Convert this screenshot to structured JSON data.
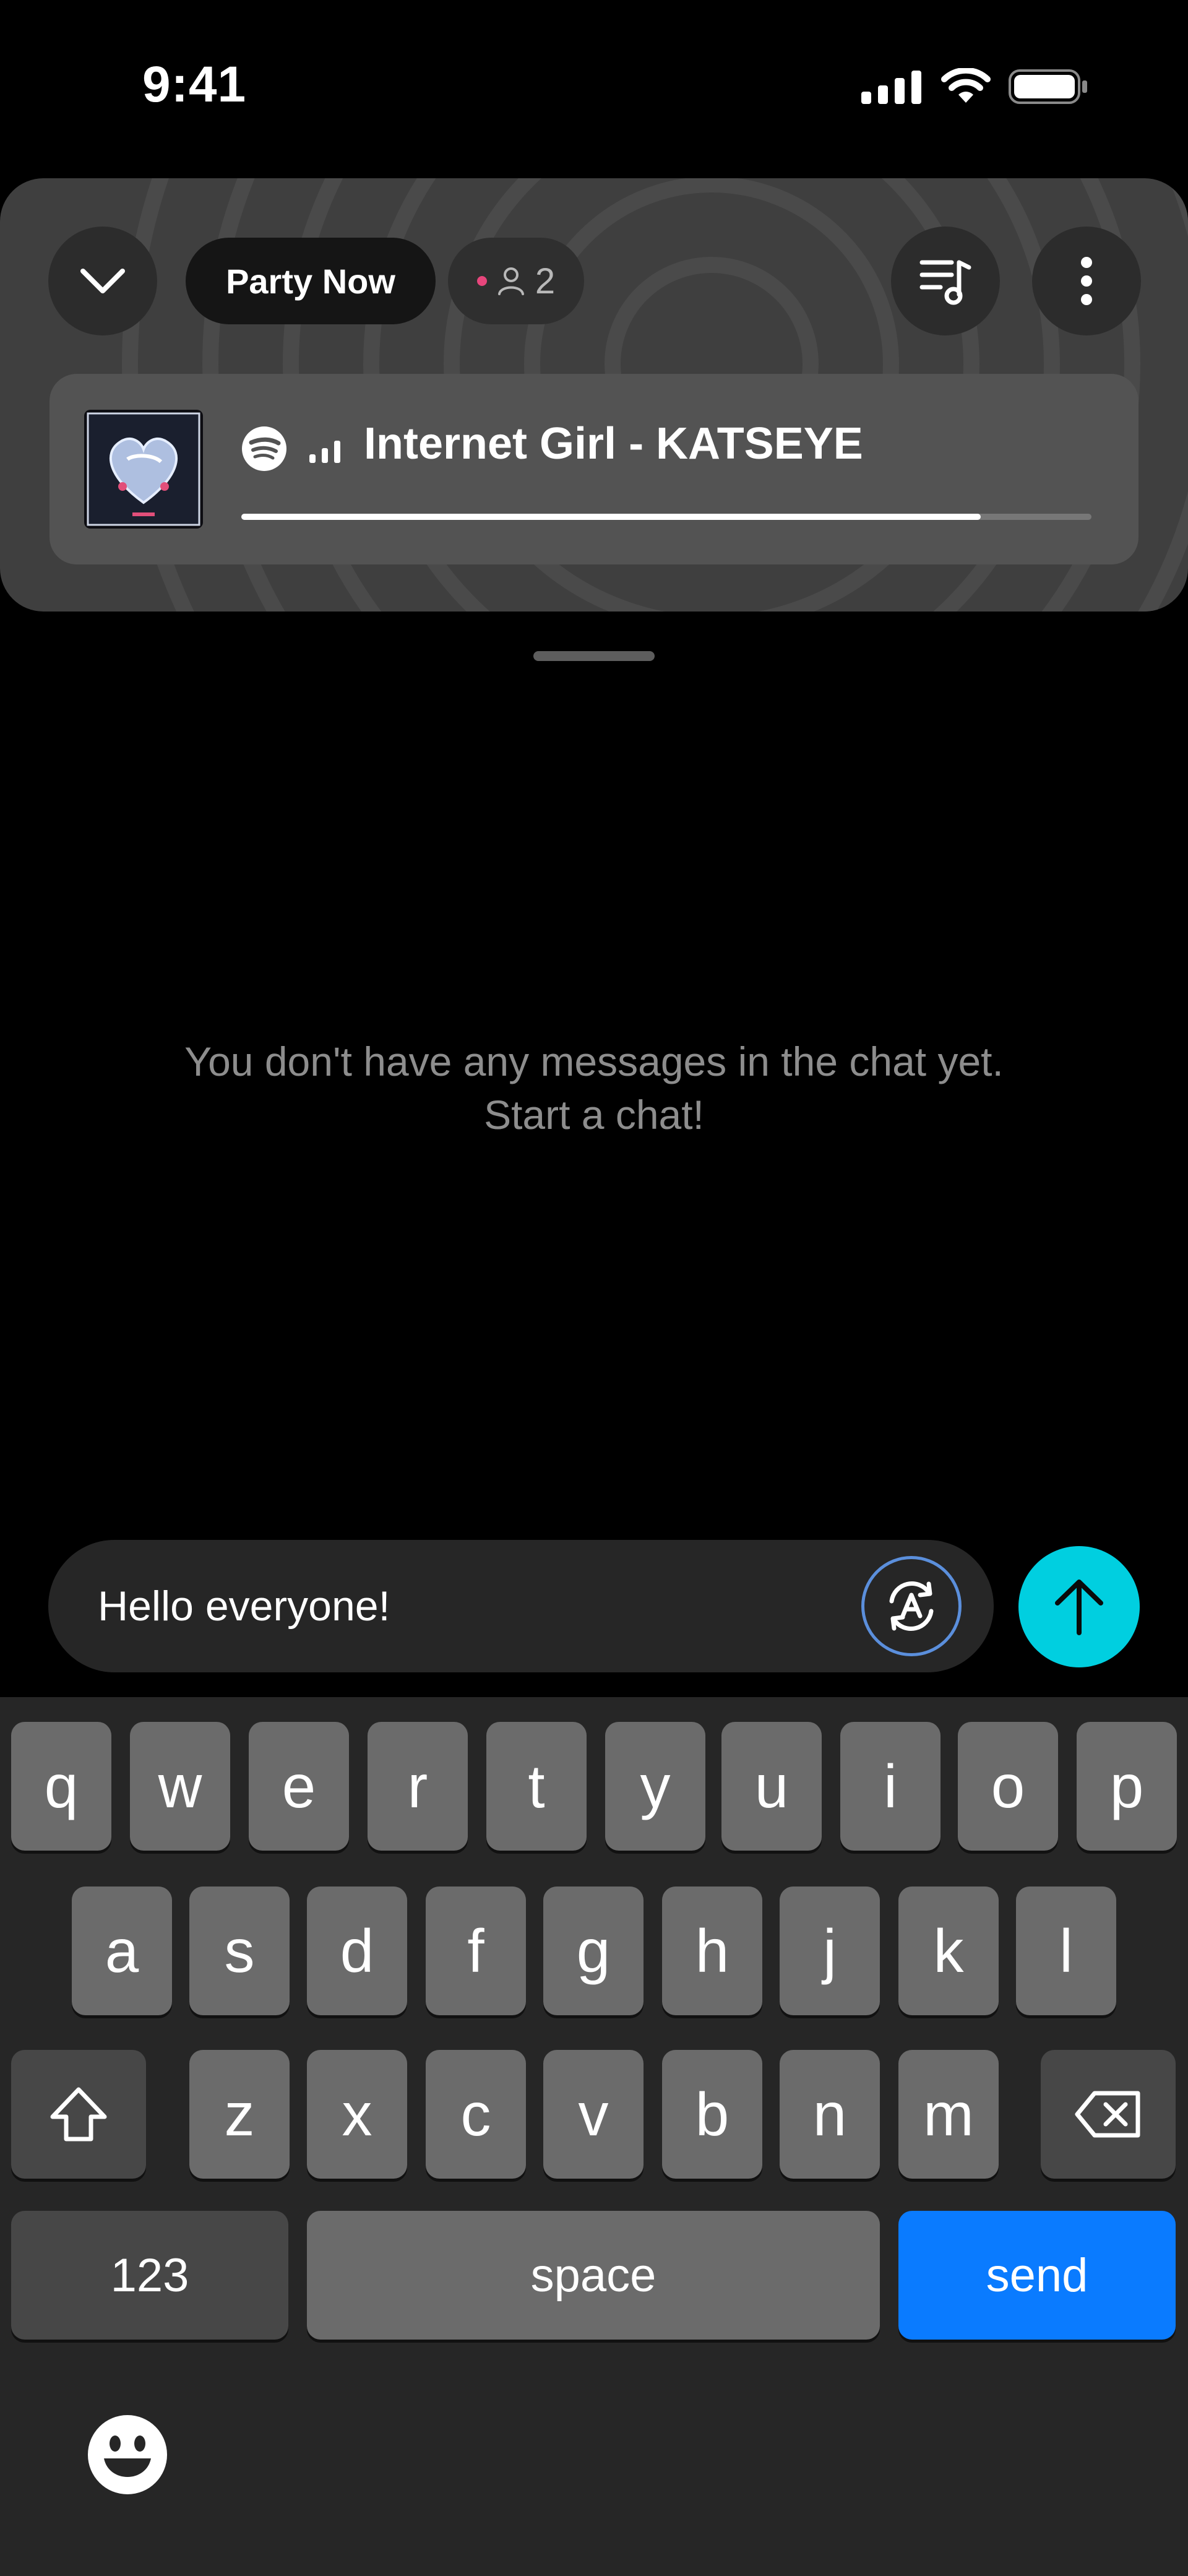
{
  "status_bar": {
    "time": "9:41",
    "icons": [
      "cellular-signal-icon",
      "wifi-icon",
      "battery-icon"
    ]
  },
  "party": {
    "collapse_icon": "chevron-down-icon",
    "title": "Party Now",
    "listeners_count": "2",
    "queue_icon": "music-queue-icon",
    "more_icon": "more-vertical-icon"
  },
  "now_playing": {
    "source_icon": "spotify-icon",
    "playing_indicator_icon": "equalizer-bars-icon",
    "title": "Internet Girl - KATSEYE",
    "progress": 0.87
  },
  "chat": {
    "empty_line1": "You don't have any messages in the chat yet.",
    "empty_line2": "Start a chat!"
  },
  "composer": {
    "value": "Hello everyone!",
    "translate_icon": "auto-translate-icon",
    "send_icon": "arrow-up-icon"
  },
  "keyboard": {
    "row1": [
      "q",
      "w",
      "e",
      "r",
      "t",
      "y",
      "u",
      "i",
      "o",
      "p"
    ],
    "row2": [
      "a",
      "s",
      "d",
      "f",
      "g",
      "h",
      "j",
      "k",
      "l"
    ],
    "row3": [
      "z",
      "x",
      "c",
      "v",
      "b",
      "n",
      "m"
    ],
    "numbers_label": "123",
    "space_label": "space",
    "send_label": "send",
    "shift_icon": "shift-icon",
    "delete_icon": "backspace-icon",
    "emoji_icon": "emoji-icon"
  },
  "colors": {
    "accent_send": "#00cfe0",
    "keyboard_send": "#0a7bff",
    "live_dot": "#e7467c",
    "translate_ring": "#5b8fdc"
  }
}
